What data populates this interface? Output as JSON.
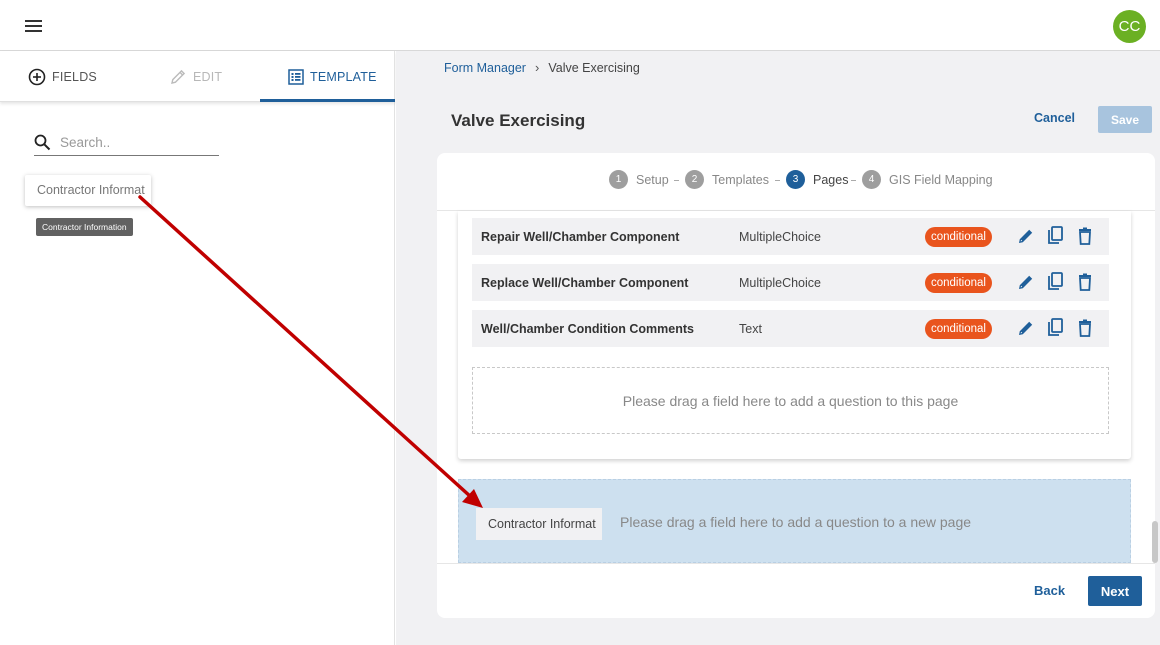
{
  "header": {
    "menu_icon": "menu-icon",
    "avatar_initials": "CC",
    "avatar_color": "#6bb023"
  },
  "left_panel": {
    "tabs": [
      {
        "label": "FIELDS",
        "icon": "plus-circle-icon",
        "state": "normal"
      },
      {
        "label": "EDIT",
        "icon": "pencil-icon",
        "state": "disabled"
      },
      {
        "label": "TEMPLATE",
        "icon": "list-icon",
        "state": "active"
      }
    ],
    "search": {
      "placeholder": "Search..",
      "value": ""
    },
    "drag_item": "Contractor Informat",
    "tooltip": "Contractor Information"
  },
  "breadcrumb": {
    "root": "Form Manager",
    "current": "Valve Exercising"
  },
  "page_title": "Valve Exercising",
  "actions": {
    "cancel": "Cancel",
    "save": "Save"
  },
  "steps": [
    {
      "num": "1",
      "label": "Setup"
    },
    {
      "num": "2",
      "label": "Templates"
    },
    {
      "num": "3",
      "label": "Pages",
      "active": true
    },
    {
      "num": "4",
      "label": "GIS Field Mapping"
    }
  ],
  "questions": [
    {
      "label": "Repair Well/Chamber Component",
      "type": "MultipleChoice",
      "badge": "conditional"
    },
    {
      "label": "Replace Well/Chamber Component",
      "type": "MultipleChoice",
      "badge": "conditional"
    },
    {
      "label": "Well/Chamber Condition Comments",
      "type": "Text",
      "badge": "conditional"
    }
  ],
  "dropzone_text": "Please drag a field here to add a question to this page",
  "new_page_zone": {
    "text": "Please drag a field here to add a question to a new page",
    "drag_item": "Contractor Informat"
  },
  "footer": {
    "back": "Back",
    "next": "Next"
  },
  "colors": {
    "primary": "#1f5f9a",
    "badge": "#e9541d",
    "save_disabled": "#a8c4de",
    "dropzone_highlight": "#cde0ef",
    "arrow": "#c00000"
  }
}
